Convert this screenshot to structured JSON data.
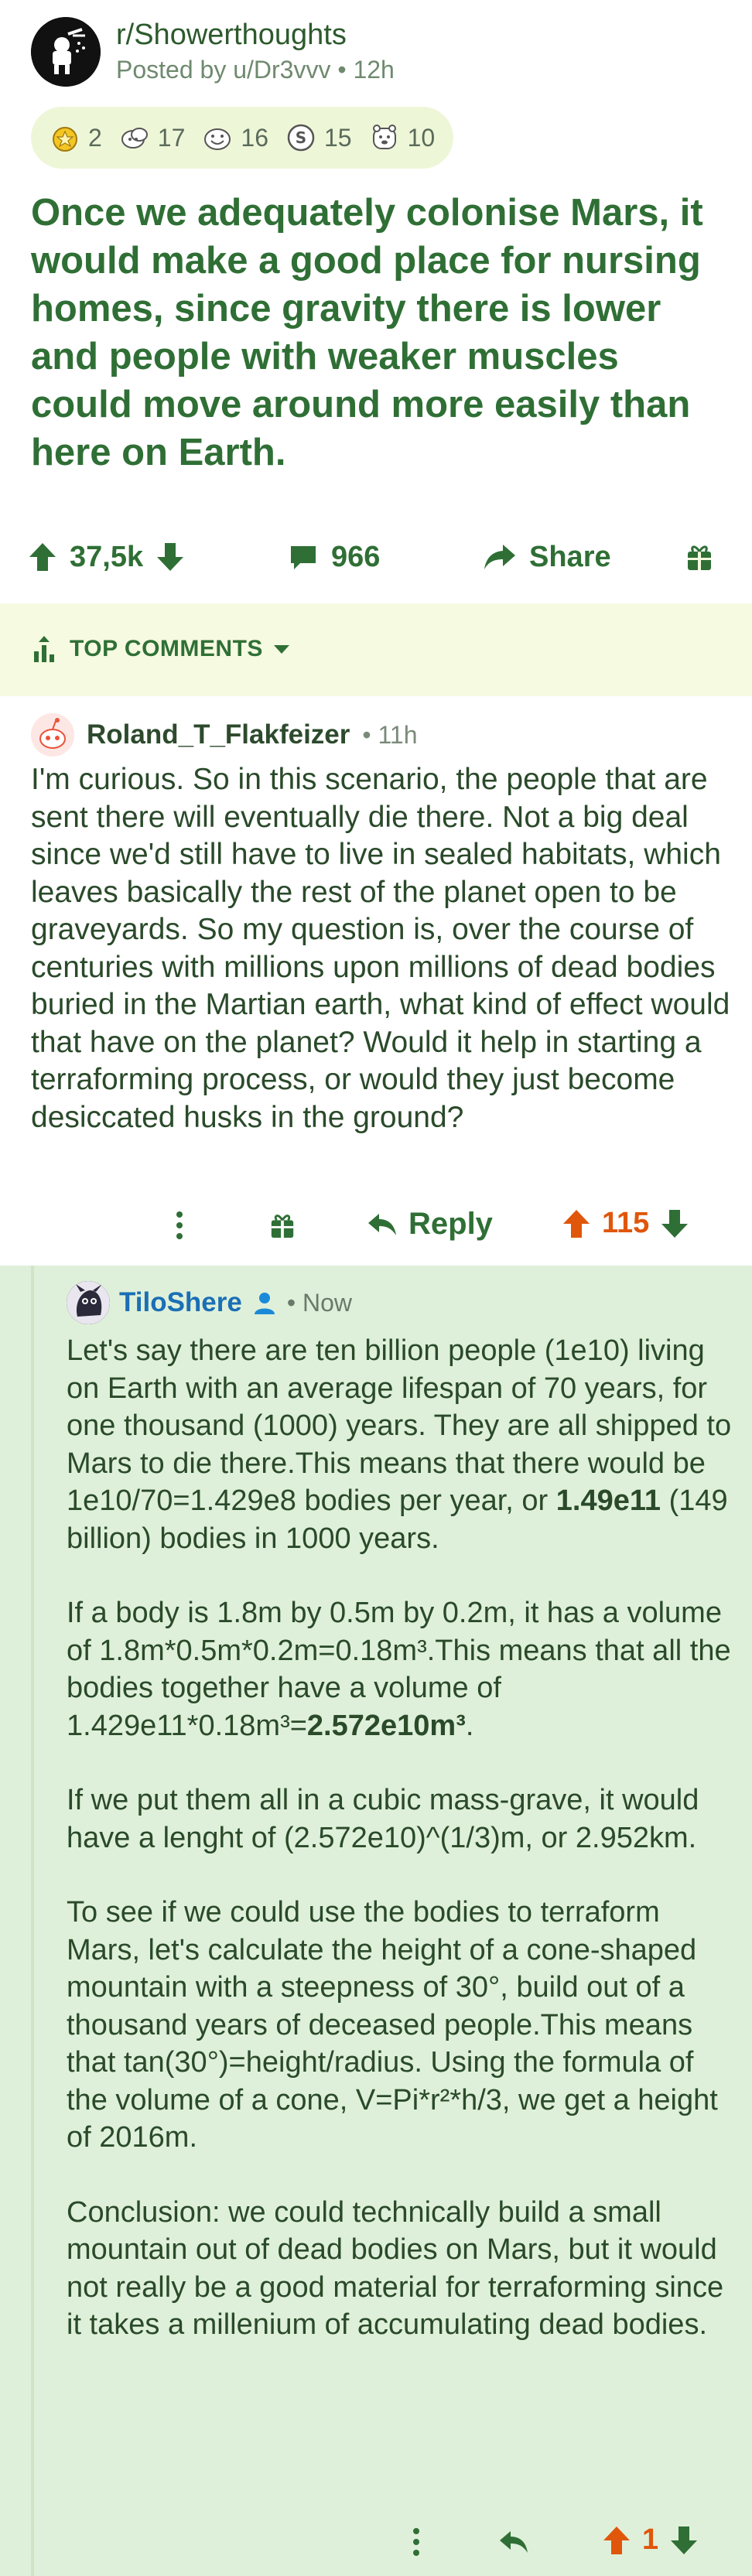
{
  "post": {
    "subreddit": "r/Showerthoughts",
    "posted_by": "Posted by u/Dr3vvv",
    "age": "12h",
    "awards": [
      {
        "icon": "gold-award-icon",
        "count": "2"
      },
      {
        "icon": "wholesome-award-icon",
        "count": "17"
      },
      {
        "icon": "silver-award-icon",
        "count": "16"
      },
      {
        "icon": "coin-award-icon",
        "count": "15"
      },
      {
        "icon": "hugz-award-icon",
        "count": "10"
      }
    ],
    "title": "Once we adequately colonise Mars, it would make a good place for nursing homes, since gravity there is lower and people with weaker muscles could move around more easily than here on Earth.",
    "score": "37,5k",
    "comments": "966",
    "share_label": "Share"
  },
  "sort": {
    "label": "TOP COMMENTS"
  },
  "comment1": {
    "author": "Roland_T_Flakfeizer",
    "age": "11h",
    "body": "I'm curious. So in this scenario, the people that are sent there will eventually die there. Not a big deal since we'd still have to live in sealed habitats, which leaves basically the rest of the planet open to be graveyards. So my question is, over the course of centuries with millions upon millions of dead bodies buried in the Martian earth, what kind of effect would that have on the planet? Would it help in starting a terraforming process, or would they just become desiccated husks in the ground?",
    "reply_label": "Reply",
    "score": "115"
  },
  "comment2": {
    "author": "TiloShere",
    "age": "Now",
    "p1_a": "Let's say there are ten billion people (1e10) living on Earth with an average lifespan of 70 years, for one thousand (1000) years. They are all shipped to Mars to die there.This means that there would be 1e10/70=1.429e8 bodies per year, or ",
    "p1_bold": "1.49e11",
    "p1_b": " (149 billion) bodies in 1000 years.",
    "p2_a": "If a body is 1.8m by 0.5m by 0.2m, it has a volume of 1.8m*0.5m*0.2m=0.18m³.This means that all the bodies together have a volume of 1.429e11*0.18m³=",
    "p2_bold": "2.572e10m³",
    "p2_b": ".",
    "p3": "If we put them all in a cubic mass-grave, it would have a lenght of (2.572e10)^(1/3)m, or 2.952km.",
    "p4": "To see if we could use the bodies to terraform Mars, let's calculate the height of a cone-shaped mountain with a steepness of 30°, build out of a thousand years of deceased people.This means that tan(30°)=height/radius. Using the formula of the volume of a cone, V=Pi*r²*h/3, we get a height of 2016m.",
    "p5": "Conclusion: we could technically build a small mountain out of dead bodies on Mars, but it would not really be a good material for terraforming since it takes a millenium of accumulating dead bodies.",
    "score": "1"
  },
  "colors": {
    "accent_green": "#2f6f35",
    "upvote_orange": "#e0560b",
    "reply_bg": "#dff0da",
    "sort_bg": "#f5fae0",
    "username_blue": "#1a6fb5"
  }
}
